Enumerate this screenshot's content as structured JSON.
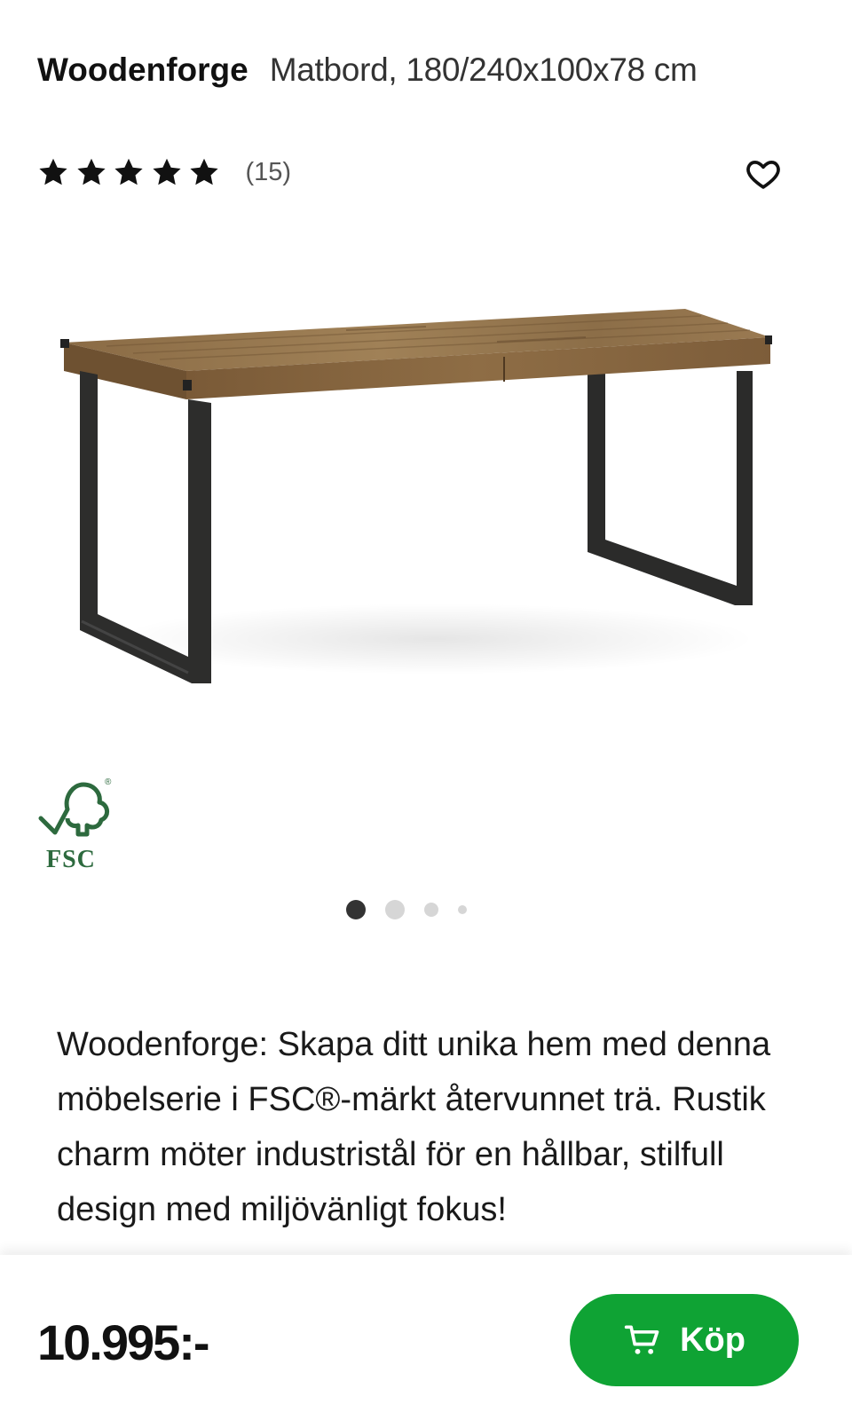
{
  "header": {
    "brand": "Woodenforge",
    "product_name": "Matbord, 180/240x100x78 cm"
  },
  "rating": {
    "stars": 5,
    "max_stars": 5,
    "review_count": "(15)"
  },
  "icons": {
    "favorite": "heart-outline-icon",
    "cart": "cart-icon",
    "star": "star-icon"
  },
  "certification": {
    "label": "FSC",
    "mark": "®"
  },
  "carousel": {
    "total_slides": 4,
    "active_slide": 1
  },
  "description": "Woodenforge: Skapa ditt unika hem med denna möbelserie i FSC®-märkt återvunnet trä. Rustik charm möter industristål för en hållbar, stilfull design med miljövänligt fokus!",
  "footer": {
    "price": "10.995:-",
    "buy_label": "Köp"
  },
  "colors": {
    "buy_button": "#0fa334",
    "fsc_green": "#2d6a3e",
    "active_dot": "#333333",
    "inactive_dot": "#d6d6d6"
  }
}
